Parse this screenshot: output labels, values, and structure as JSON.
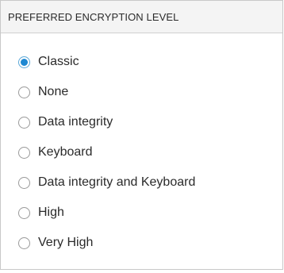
{
  "panel": {
    "title": "PREFERRED ENCRYPTION LEVEL"
  },
  "options": [
    {
      "label": "Classic",
      "selected": true
    },
    {
      "label": "None",
      "selected": false
    },
    {
      "label": "Data integrity",
      "selected": false
    },
    {
      "label": "Keyboard",
      "selected": false
    },
    {
      "label": "Data integrity and Keyboard",
      "selected": false
    },
    {
      "label": "High",
      "selected": false
    },
    {
      "label": "Very High",
      "selected": false
    }
  ],
  "colors": {
    "accent": "#1e88d2",
    "header_bg": "#f4f4f4",
    "border": "#c8c8c8"
  }
}
